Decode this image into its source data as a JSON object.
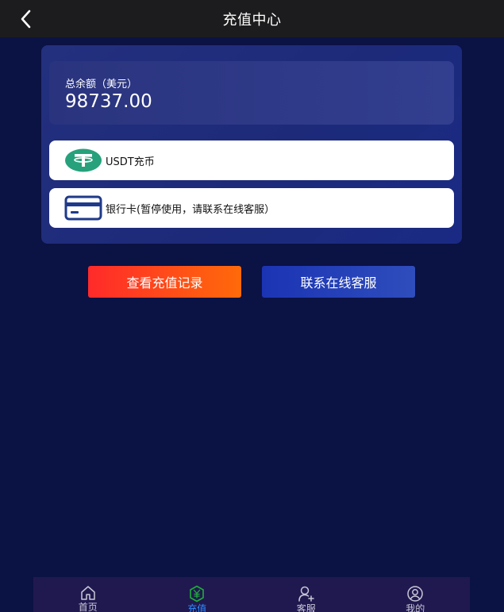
{
  "header": {
    "title": "充值中心"
  },
  "balance": {
    "label": "总余额（美元）",
    "value": "98737.00"
  },
  "methods": [
    {
      "label": "USDT充币",
      "icon": "usdt-tether-icon"
    },
    {
      "label": "银行卡(暂停使用，请联系在线客服）",
      "icon": "bank-card-icon"
    }
  ],
  "actions": {
    "history_label": "查看充值记录",
    "service_label": "联系在线客服"
  },
  "tabbar": {
    "items": [
      {
        "label": "首页",
        "icon": "home-icon",
        "active": false
      },
      {
        "label": "充值",
        "icon": "yen-hexagon-icon",
        "active": true
      },
      {
        "label": "客服",
        "icon": "user-add-icon",
        "active": false
      },
      {
        "label": "我的",
        "icon": "profile-circle-icon",
        "active": false
      }
    ]
  },
  "colors": {
    "background": "#0b1244",
    "header": "#1c1c1e",
    "tether_green": "#26a17b",
    "active_tab": "#2d8cff",
    "history_button_start": "#ff2a2a",
    "history_button_end": "#ff6a0a",
    "service_button": "#1b34b4"
  }
}
